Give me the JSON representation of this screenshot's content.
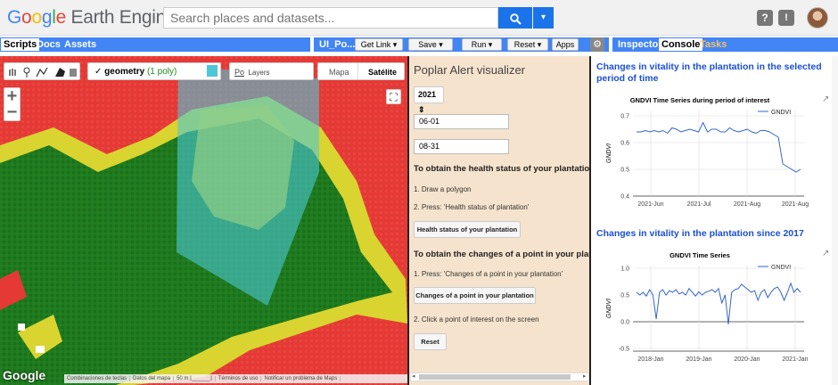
{
  "header": {
    "logo": {
      "g": "G",
      "o1": "o",
      "o2": "o",
      "g2": "g",
      "l": "l",
      "e": "e",
      "rest": "Earth Engine"
    },
    "search_placeholder": "Search places and datasets...",
    "help_label": "?",
    "feedback_label": "!"
  },
  "left_tabs": [
    {
      "label": "Scripts",
      "active": true
    },
    {
      "label": "Docs",
      "active": false
    },
    {
      "label": "Assets",
      "active": false
    }
  ],
  "editor_toolbar": {
    "script_name": "UI_Po...",
    "get_link": "Get Link",
    "save": "Save",
    "run": "Run",
    "reset": "Reset",
    "apps": "Apps",
    "dropdown_arrow": "▾"
  },
  "right_tabs": [
    {
      "label": "Inspector",
      "active": false
    },
    {
      "label": "Console",
      "active": true
    },
    {
      "label": "Tasks",
      "active": false,
      "color": "#f5a623"
    }
  ],
  "map": {
    "geometry_label": "geometry",
    "geometry_count": "(1 poly)",
    "geometry_color": "#4dc6d6",
    "layers_hint": "Po",
    "layers_label": "Layers",
    "map_type_options": [
      "Mapa",
      "Satélite"
    ],
    "map_type_selected": "Satélite",
    "zoom_in": "+",
    "zoom_out": "−",
    "google_logo": "Google",
    "footer": [
      "Combinaciones de teclas",
      "Datos del mapa",
      "50 m",
      "Términos de uso",
      "Notificar un problema de Maps"
    ],
    "class_colors": {
      "red": "#e53935",
      "yellow": "#d4d42a",
      "green": "#1f7a1f",
      "white": "#ffffff"
    }
  },
  "panel": {
    "title": "Poplar Alert visualizer",
    "year": "2021",
    "start_date": "06-01",
    "end_date": "08-31",
    "health_heading": "To obtain the health status of your plantation:",
    "health_steps": [
      "1. Draw a polygon",
      "2. Press: 'Health status of plantation'"
    ],
    "health_button": "Health status of your plantation",
    "changes_heading": "To obtain the changes of a point in your planta",
    "changes_step1": "1. Press: 'Changes of a point in your plantation'",
    "changes_button": "Changes of a point in your plantation",
    "changes_step2": "2. Click a point of interest on the screen",
    "reset_button": "Reset"
  },
  "console": {
    "title1": "Changes in vitality in the plantation in the selected period of time",
    "title2": "Changes in vitality in the plantation since 2017",
    "popout_icon": "↗"
  },
  "chart_data": [
    {
      "type": "line",
      "title": "GNDVI Time Series during period of interest",
      "ylabel": "GNDVI",
      "xlabel": "",
      "legend": "top-right",
      "series": [
        {
          "name": "GNDVI",
          "color": "#3366cc",
          "values": [
            0.64,
            0.64,
            0.645,
            0.64,
            0.645,
            0.64,
            0.645,
            0.635,
            0.655,
            0.65,
            0.64,
            0.645,
            0.65,
            0.645,
            0.64,
            0.675,
            0.64,
            0.65,
            0.65,
            0.64,
            0.64,
            0.655,
            0.645,
            0.64,
            0.645,
            0.65,
            0.64,
            0.635,
            0.645,
            0.645,
            0.64,
            0.63,
            0.62,
            0.52,
            0.51,
            0.5,
            0.49,
            0.5
          ]
        }
      ],
      "x_ticks": [
        "2021-Jun",
        "2021-Jul",
        "2021-Aug",
        "2021-Aug"
      ],
      "y_ticks": [
        0.4,
        0.5,
        0.6,
        0.7
      ],
      "ylim": [
        0.4,
        0.72
      ],
      "grid": true
    },
    {
      "type": "line",
      "title": "GNDVI Time Series",
      "ylabel": "GNDVI",
      "xlabel": "",
      "legend": "top-right",
      "series": [
        {
          "name": "GNDVI",
          "color": "#3366cc",
          "values": [
            0.55,
            0.5,
            0.55,
            0.48,
            0.6,
            0.5,
            0.05,
            0.55,
            0.6,
            0.5,
            0.58,
            0.55,
            0.6,
            0.52,
            0.55,
            0.5,
            0.62,
            0.55,
            0.48,
            0.56,
            0.5,
            0.55,
            0.57,
            0.6,
            0.55,
            0.62,
            0.35,
            0.5,
            -0.05,
            0.55,
            0.6,
            0.62,
            0.7,
            0.65,
            0.6,
            0.55,
            0.58,
            0.4,
            0.55,
            0.6,
            0.45,
            0.55,
            0.62,
            0.65,
            0.55,
            0.4,
            0.55,
            0.72,
            0.55,
            0.62,
            0.55
          ]
        }
      ],
      "x_ticks": [
        "2018-Jan",
        "2019-Jan",
        "2020-Jan",
        "2021-Jan"
      ],
      "y_ticks": [
        -0.5,
        0.0,
        0.5,
        1.0
      ],
      "ylim": [
        -0.55,
        1.05
      ],
      "grid": true
    }
  ]
}
